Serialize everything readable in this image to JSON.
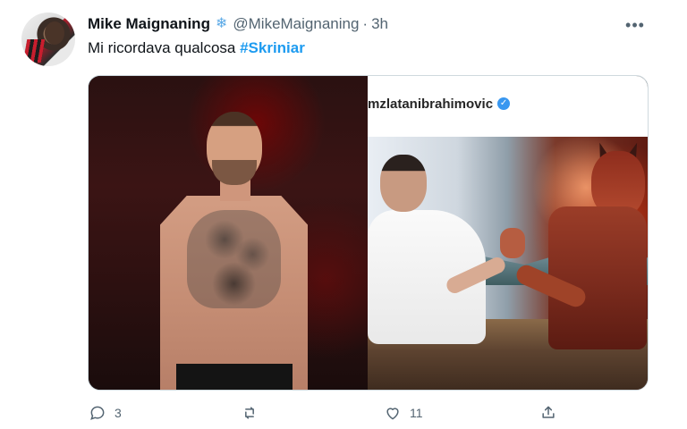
{
  "tweet": {
    "author_name": "Mike Maignaning",
    "author_handle": "@MikeMaignaning",
    "separator": "·",
    "time": "3h",
    "text_prefix": "Mi ricordava qualcosa ",
    "hashtag": "#Skriniar"
  },
  "media": {
    "instagram_username": "mzlatanibrahimovic"
  },
  "actions": {
    "reply_count": "3",
    "like_count": "11"
  },
  "icons": {
    "snow": "❄",
    "more": "•••",
    "verified": "✓"
  }
}
